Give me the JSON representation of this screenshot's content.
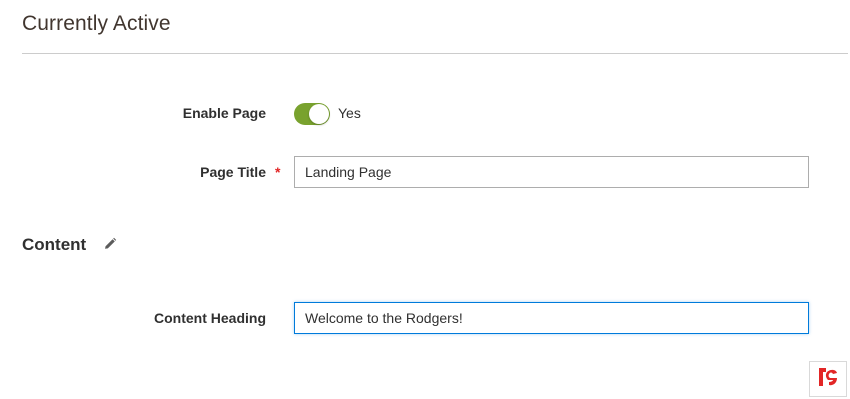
{
  "section": {
    "title": "Currently Active"
  },
  "enable_page": {
    "label": "Enable Page",
    "state": "on",
    "status_text": "Yes",
    "accent_color": "#79a22e"
  },
  "page_title": {
    "label": "Page Title",
    "required_marker": "*",
    "value": "Landing Page"
  },
  "content": {
    "title": "Content",
    "edit_icon": "pencil-icon"
  },
  "content_heading": {
    "label": "Content Heading",
    "value": "Welcome to the Rodgers!",
    "focus_color": "#007bdb"
  },
  "badge": {
    "icon": "logo-icon",
    "color": "#e22626"
  }
}
